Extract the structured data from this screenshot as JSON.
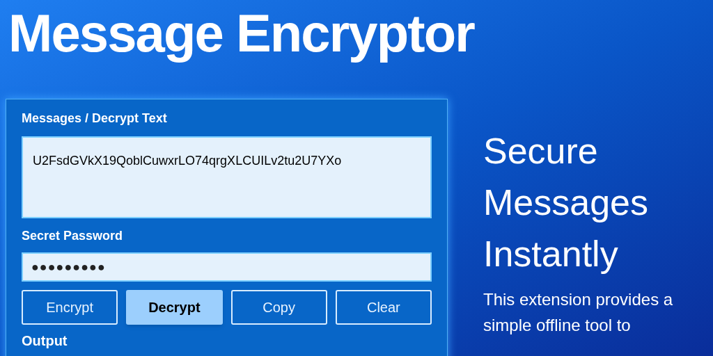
{
  "title": "Message Encryptor",
  "panel": {
    "message_label": "Messages / Decrypt Text",
    "message_value": "U2FsdGVkX19QoblCuwxrLO74qrgXLCUILv2tu2U7YXo",
    "password_label": "Secret Password",
    "password_masked": "●●●●●●●●●",
    "buttons": [
      {
        "label": "Encrypt",
        "selected": false
      },
      {
        "label": "Decrypt",
        "selected": true
      },
      {
        "label": "Copy",
        "selected": false
      },
      {
        "label": "Clear",
        "selected": false
      }
    ],
    "output_label": "Output"
  },
  "hero": {
    "heading_lines": [
      "Secure",
      "Messages",
      "Instantly"
    ],
    "description": "This extension provides a simple offline tool to"
  }
}
